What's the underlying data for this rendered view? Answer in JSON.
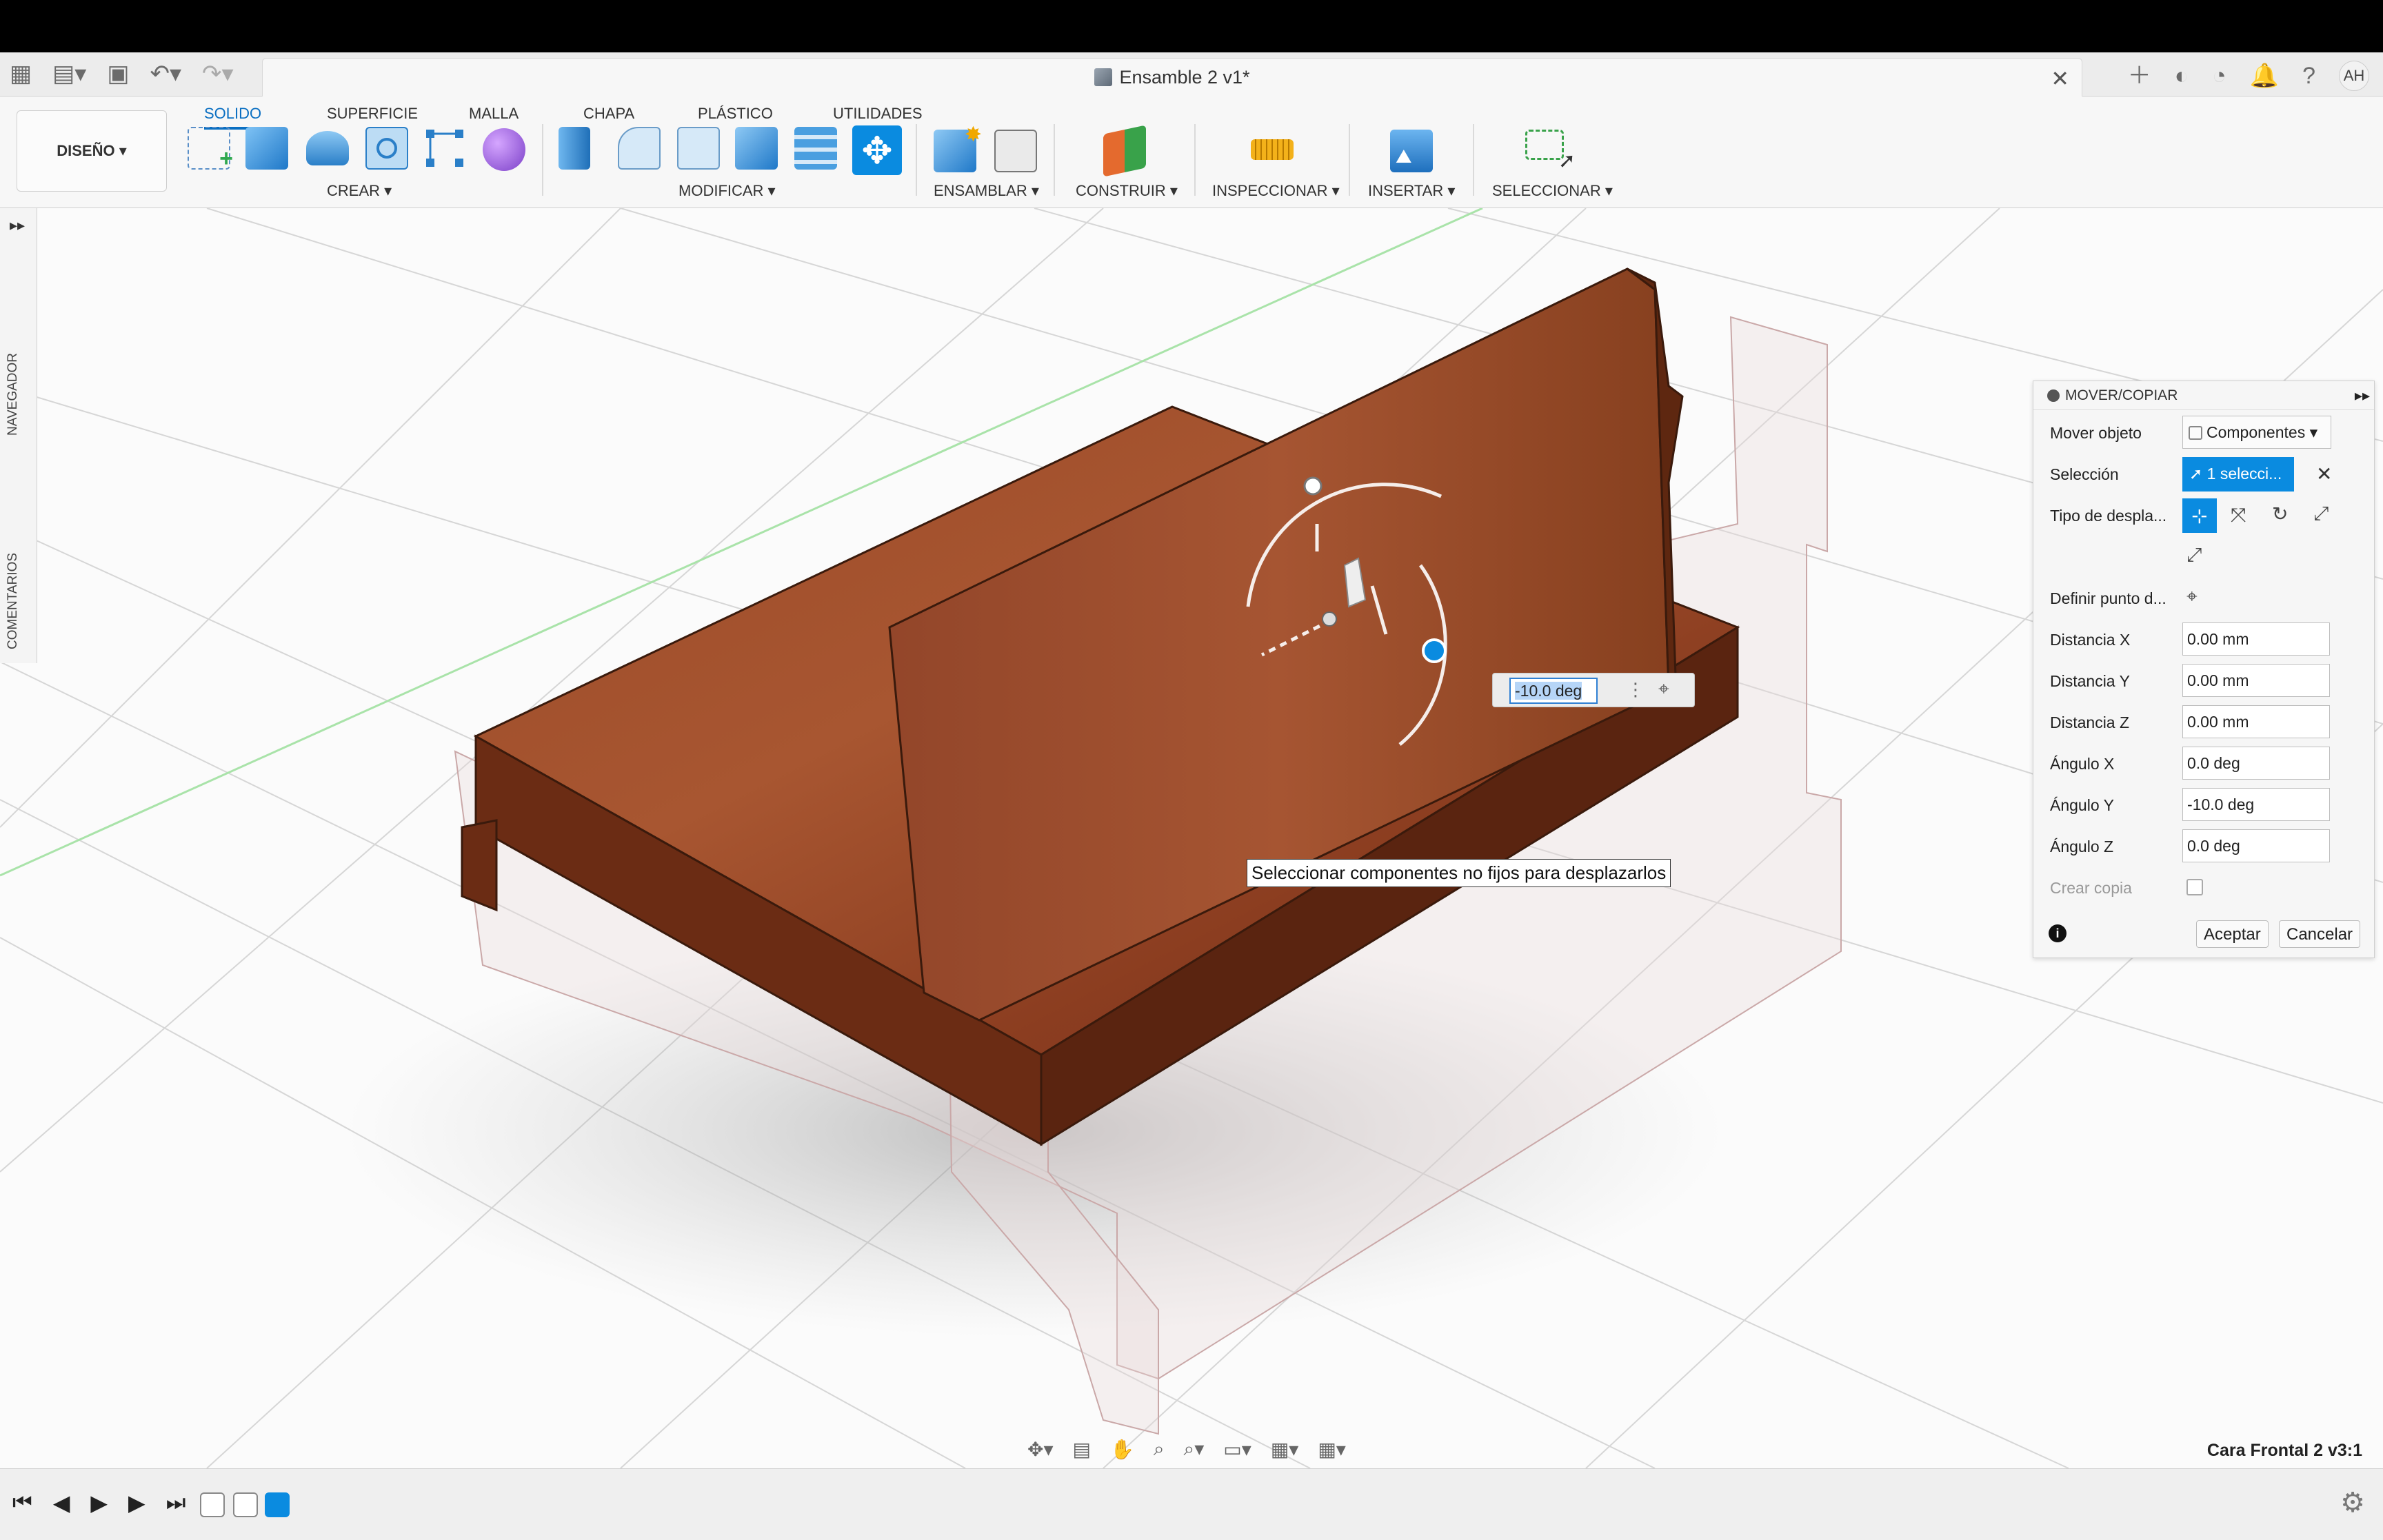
{
  "app": {
    "document_title": "Ensamble 2 v1*",
    "user_initials": "AH"
  },
  "ribbon": {
    "workspace_label": "DISEÑO ▾",
    "tabs": [
      "SOLIDO",
      "SUPERFICIE",
      "MALLA",
      "CHAPA",
      "PLÁSTICO",
      "UTILIDADES"
    ],
    "groups": {
      "crear": "CREAR ▾",
      "modificar": "MODIFICAR ▾",
      "ensamblar": "ENSAMBLAR ▾",
      "construir": "CONSTRUIR ▾",
      "inspeccionar": "INSPECCIONAR ▾",
      "insertar": "INSERTAR ▾",
      "seleccionar": "SELECCIONAR ▾"
    }
  },
  "leftpanel": {
    "navegador": "NAVEGADOR",
    "comentarios": "COMENTARIOS"
  },
  "move_panel": {
    "title": "MOVER/COPIAR",
    "mover_objeto_label": "Mover objeto",
    "mover_objeto_value": "Componentes",
    "seleccion_label": "Selección",
    "seleccion_value": "1 selecci...",
    "tipo_label": "Tipo de despla...",
    "definir_label": "Definir punto d...",
    "distancia_x_label": "Distancia X",
    "distancia_x": "0.00 mm",
    "distancia_y_label": "Distancia Y",
    "distancia_y": "0.00 mm",
    "distancia_z_label": "Distancia Z",
    "distancia_z": "0.00 mm",
    "angulo_x_label": "Ángulo X",
    "angulo_x": "0.0 deg",
    "angulo_y_label": "Ángulo Y",
    "angulo_y": "-10.0 deg",
    "angulo_z_label": "Ángulo Z",
    "angulo_z": "0.0 deg",
    "crear_copia_label": "Crear copia",
    "aceptar": "Aceptar",
    "cancelar": "Cancelar"
  },
  "canvas": {
    "inline_value": "-10.0 deg",
    "tooltip": "Seleccionar componentes no fijos para desplazarlos",
    "status_component": "Cara Frontal 2 v3:1"
  },
  "colors": {
    "accent": "#0a6fc2",
    "wood": "#8a3f22",
    "panel_bg": "#f6f6f6"
  }
}
